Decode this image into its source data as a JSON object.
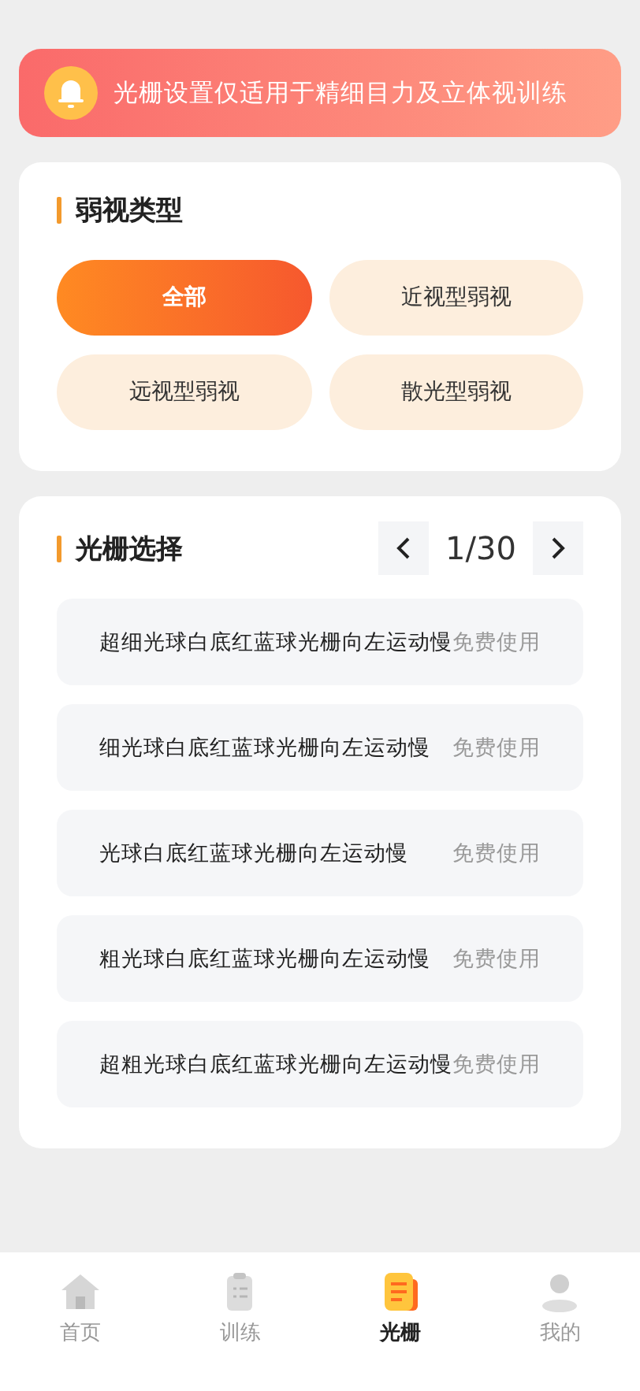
{
  "notice": {
    "text": "光栅设置仅适用于精细目力及立体视训练"
  },
  "amblyopia_types": {
    "title": "弱视类型",
    "options": [
      {
        "label": "全部",
        "selected": true
      },
      {
        "label": "近视型弱视",
        "selected": false
      },
      {
        "label": "远视型弱视",
        "selected": false
      },
      {
        "label": "散光型弱视",
        "selected": false
      }
    ]
  },
  "grating_select": {
    "title": "光栅选择",
    "page": "1/30",
    "items": [
      {
        "name": "超细光球白底红蓝球光栅向左运动慢",
        "price": "免费使用"
      },
      {
        "name": "细光球白底红蓝球光栅向左运动慢",
        "price": "免费使用"
      },
      {
        "name": "光球白底红蓝球光栅向左运动慢",
        "price": "免费使用"
      },
      {
        "name": "粗光球白底红蓝球光栅向左运动慢",
        "price": "免费使用"
      },
      {
        "name": "超粗光球白底红蓝球光栅向左运动慢",
        "price": "免费使用"
      }
    ]
  },
  "tab_bar": [
    {
      "kind": "home",
      "label": "首页",
      "selected": false
    },
    {
      "kind": "train",
      "label": "训练",
      "selected": false
    },
    {
      "kind": "grating",
      "label": "光栅",
      "selected": true
    },
    {
      "kind": "me",
      "label": "我的",
      "selected": false
    }
  ]
}
